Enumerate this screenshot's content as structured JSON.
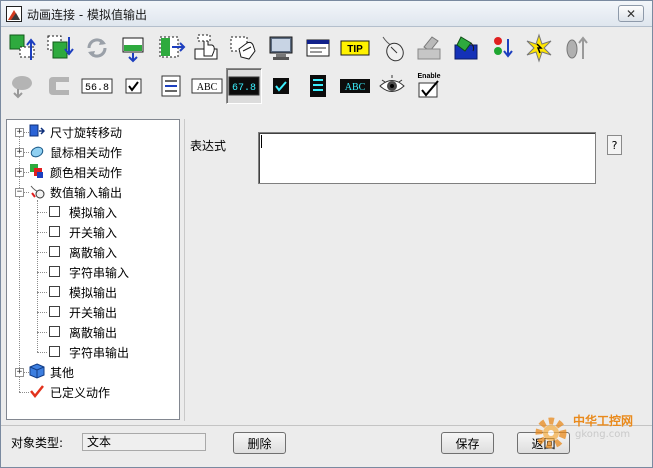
{
  "window": {
    "title": "动画连接 - 模拟值输出",
    "close_glyph": "✕"
  },
  "toolbar": {
    "row1": [
      {
        "name": "size-move-icon"
      },
      {
        "name": "move-icon"
      },
      {
        "name": "rotate-icon"
      },
      {
        "name": "fill-icon"
      },
      {
        "name": "move-horizontal-icon"
      },
      {
        "name": "touch-icon"
      },
      {
        "name": "click-icon"
      },
      {
        "name": "monitor-icon"
      },
      {
        "name": "window-icon"
      },
      {
        "name": "tooltip-icon",
        "text": "TIP"
      },
      {
        "name": "mouse-icon"
      },
      {
        "name": "eraser-icon"
      },
      {
        "name": "color-fill-icon"
      },
      {
        "name": "traffic-light-icon"
      },
      {
        "name": "flash-icon"
      },
      {
        "name": "zoom-out-icon"
      }
    ],
    "row2": [
      {
        "name": "drag-icon"
      },
      {
        "name": "shape-icon"
      },
      {
        "name": "analog-input-icon",
        "text": "56.8"
      },
      {
        "name": "checkbox-input-icon"
      },
      {
        "name": "list-input-icon"
      },
      {
        "name": "string-input-icon",
        "text": "ABC"
      },
      {
        "name": "analog-output-icon",
        "text": "67.8"
      },
      {
        "name": "discrete-output-icon"
      },
      {
        "name": "list-output-icon"
      },
      {
        "name": "string-output-icon",
        "text": "ABC"
      },
      {
        "name": "visibility-icon"
      },
      {
        "name": "enable-icon",
        "text": "Enable"
      }
    ],
    "selected": "analog-output-icon"
  },
  "tree": {
    "nodes": [
      {
        "label": "尺寸旋转移动",
        "expanded": false
      },
      {
        "label": "鼠标相关动作",
        "expanded": false
      },
      {
        "label": "颜色相关动作",
        "expanded": false
      },
      {
        "label": "数值输入输出",
        "expanded": true,
        "children": [
          "模拟输入",
          "开关输入",
          "离散输入",
          "字符串输入",
          "模拟输出",
          "开关输出",
          "离散输出",
          "字符串输出"
        ]
      },
      {
        "label": "其他",
        "expanded": false
      },
      {
        "label": "已定义动作"
      }
    ]
  },
  "expression": {
    "label": "表达式",
    "value": "",
    "help": "?"
  },
  "footer": {
    "object_type_label": "对象类型:",
    "object_type_value": "文本",
    "delete_label": "删除",
    "save_label": "保存",
    "back_label": "返回"
  },
  "watermark": {
    "line1": "中华工控网",
    "line2": "gkong.com"
  },
  "colors": {
    "accent": "#0a24a0",
    "dialog_bg": "#ececec",
    "watermark": "#e98a1c"
  }
}
